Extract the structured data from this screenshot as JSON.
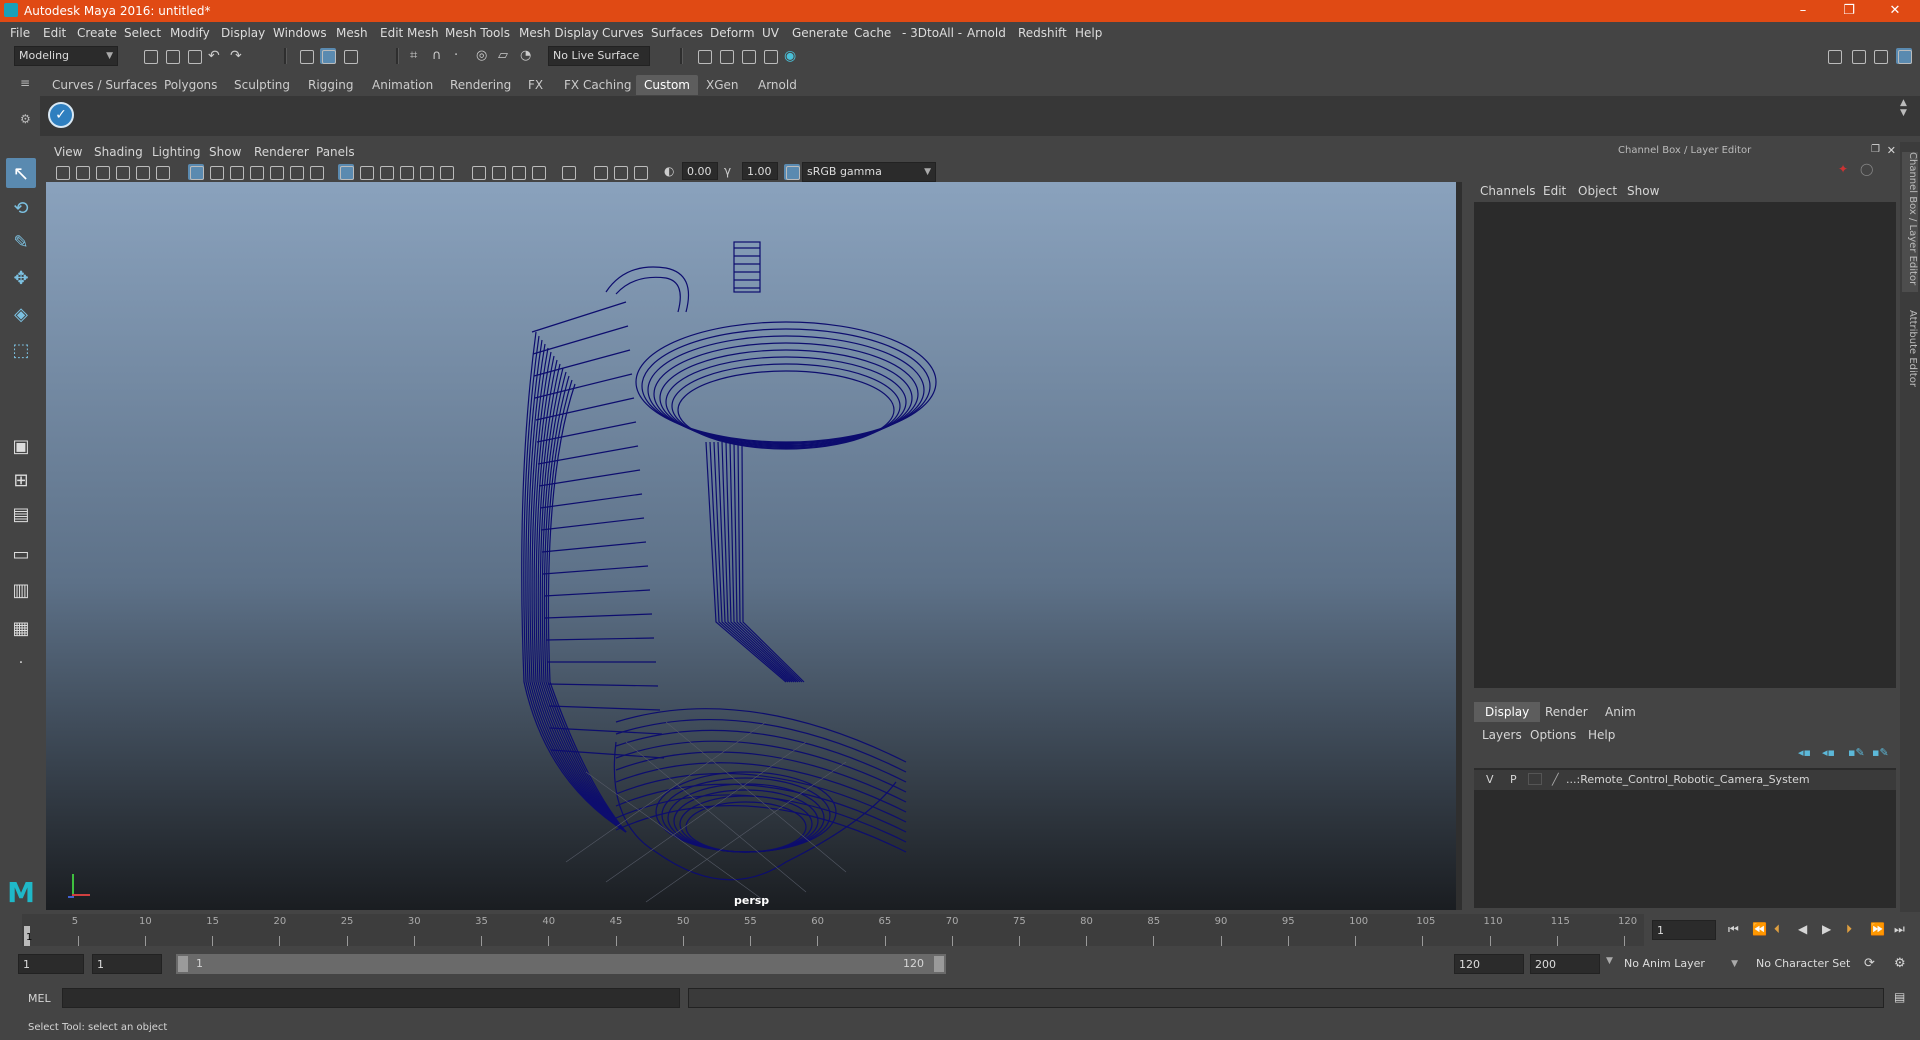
{
  "window": {
    "title": "Autodesk Maya 2016: untitled*",
    "controls": [
      "–",
      "❐",
      "✕"
    ]
  },
  "menubar": [
    "File",
    "Edit",
    "Create",
    "Select",
    "Modify",
    "Display",
    "Windows",
    "Mesh",
    "Edit Mesh",
    "Mesh Tools",
    "Mesh Display",
    "Curves",
    "Surfaces",
    "Deform",
    "UV",
    "Generate",
    "Cache",
    "- 3DtoAll -",
    "Arnold",
    "Redshift",
    "Help"
  ],
  "statusline": {
    "mode": "Modeling",
    "live_surface": "No Live Surface"
  },
  "shelf": {
    "tabs": [
      "Curves / Surfaces",
      "Polygons",
      "Sculpting",
      "Rigging",
      "Animation",
      "Rendering",
      "FX",
      "FX Caching",
      "Custom",
      "XGen",
      "Arnold"
    ],
    "active_tab": "Custom"
  },
  "viewport": {
    "menu": [
      "View",
      "Shading",
      "Lighting",
      "Show",
      "Renderer",
      "Panels"
    ],
    "exposure": "0.00",
    "gamma": "1.00",
    "color_space": "sRGB gamma",
    "camera_label": "persp",
    "wire_color": "#0d0d6e"
  },
  "channel_box": {
    "title": "Channel Box / Layer Editor",
    "menu": [
      "Channels",
      "Edit",
      "Object",
      "Show"
    ]
  },
  "layer_editor": {
    "tabs": [
      "Display",
      "Render",
      "Anim"
    ],
    "active_tab": "Display",
    "menu": [
      "Layers",
      "Options",
      "Help"
    ],
    "layer": {
      "v": "V",
      "p": "P",
      "name": "...:Remote_Control_Robotic_Camera_System"
    }
  },
  "side_tabs": [
    "Channel Box / Layer Editor",
    "Attribute Editor"
  ],
  "timeline": {
    "ticks": [
      5,
      10,
      15,
      20,
      25,
      30,
      35,
      40,
      45,
      50,
      55,
      60,
      65,
      70,
      75,
      80,
      85,
      90,
      95,
      100,
      105,
      110,
      115,
      120
    ],
    "current_frame_label": "1",
    "current_frame_field": "1"
  },
  "range": {
    "start": "1",
    "playback_start": "1",
    "slider_start": "1",
    "slider_end": "120",
    "playback_end": "120",
    "end": "200",
    "anim_layer": "No Anim Layer",
    "character_set": "No Character Set"
  },
  "command_line": {
    "label": "MEL"
  },
  "help_line": "Select Tool: select an object"
}
